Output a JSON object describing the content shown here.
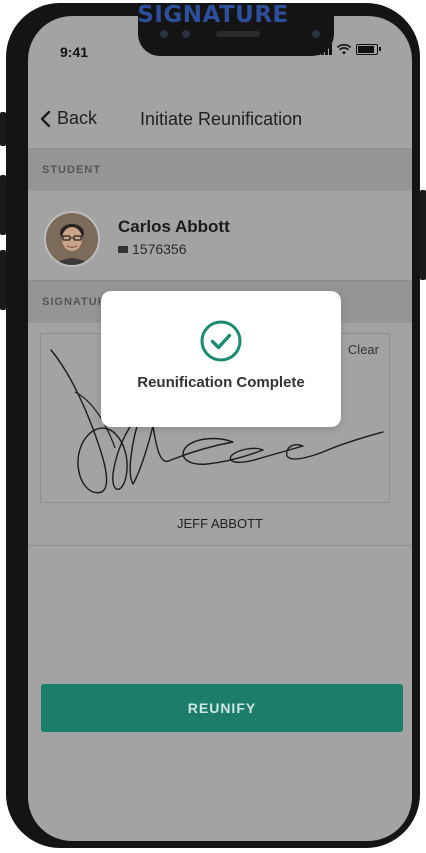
{
  "caption": "SIGNATURE",
  "status_bar": {
    "time": "9:41"
  },
  "nav": {
    "back_label": "Back",
    "title": "Initiate Reunification"
  },
  "sections": {
    "student_header": "STUDENT",
    "signature_header": "SIGNATURE"
  },
  "student": {
    "name": "Carlos Abbott",
    "id": "1576356"
  },
  "signature": {
    "clear_label": "Clear",
    "signer_name": "JEFF ABBOTT"
  },
  "action": {
    "reunify_label": "REUNIFY"
  },
  "modal": {
    "message": "Reunification Complete"
  },
  "colors": {
    "accent": "#1c7e6a",
    "check": "#1c8a72"
  }
}
